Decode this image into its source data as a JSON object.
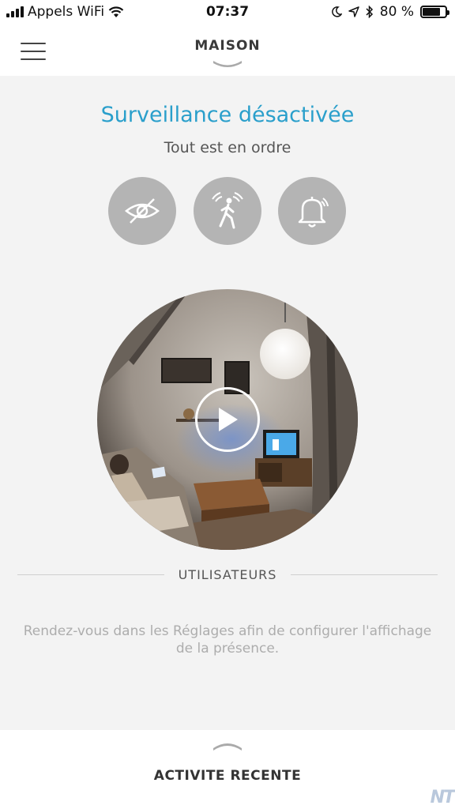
{
  "status_bar": {
    "carrier": "Appels WiFi",
    "time": "07:37",
    "battery": "80 %",
    "battery_level": 0.8
  },
  "header": {
    "title": "MAISON"
  },
  "main": {
    "status_title": "Surveillance désactivée",
    "status_subtitle": "Tout est en ordre",
    "mode_buttons": [
      {
        "icon": "privacy-eye-off-icon"
      },
      {
        "icon": "motion-detect-icon"
      },
      {
        "icon": "alarm-bell-icon"
      }
    ],
    "camera": {
      "play_icon": "play-icon"
    },
    "users_heading": "UTILISATEURS",
    "help_text": "Rendez-vous dans les Réglages afin de configurer l'affichage de la présence."
  },
  "footer": {
    "label": "ACTIVITE RECENTE",
    "watermark": "NT"
  },
  "colors": {
    "accent": "#2a9fcb",
    "button_gray": "#b4b4b4",
    "background": "#f3f3f3"
  }
}
